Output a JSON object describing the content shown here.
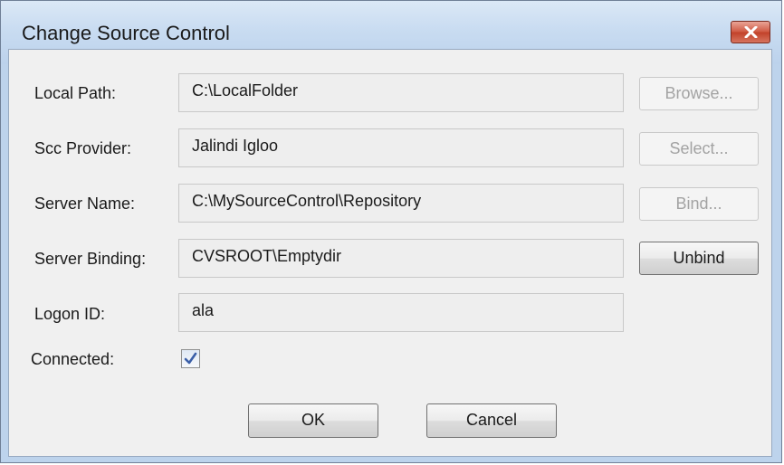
{
  "window": {
    "title": "Change Source Control",
    "close_icon": "close-icon"
  },
  "fields": {
    "local_path": {
      "label": "Local Path:",
      "value": "C:\\LocalFolder",
      "button": "Browse...",
      "button_enabled": false
    },
    "scc_provider": {
      "label": "Scc Provider:",
      "value": "Jalindi Igloo",
      "button": "Select...",
      "button_enabled": false
    },
    "server_name": {
      "label": "Server Name:",
      "value": "C:\\MySourceControl\\Repository",
      "button": "Bind...",
      "button_enabled": false
    },
    "server_binding": {
      "label": "Server Binding:",
      "value": "CVSROOT\\Emptydir",
      "button": "Unbind",
      "button_enabled": true
    },
    "logon_id": {
      "label": "Logon ID:",
      "value": "ala"
    }
  },
  "connected": {
    "label": "Connected:",
    "checked": true
  },
  "buttons": {
    "ok": "OK",
    "cancel": "Cancel"
  },
  "colors": {
    "title_bar": "#c9dcf1",
    "close_button": "#c84a34",
    "check_mark": "#3a5fa8"
  }
}
